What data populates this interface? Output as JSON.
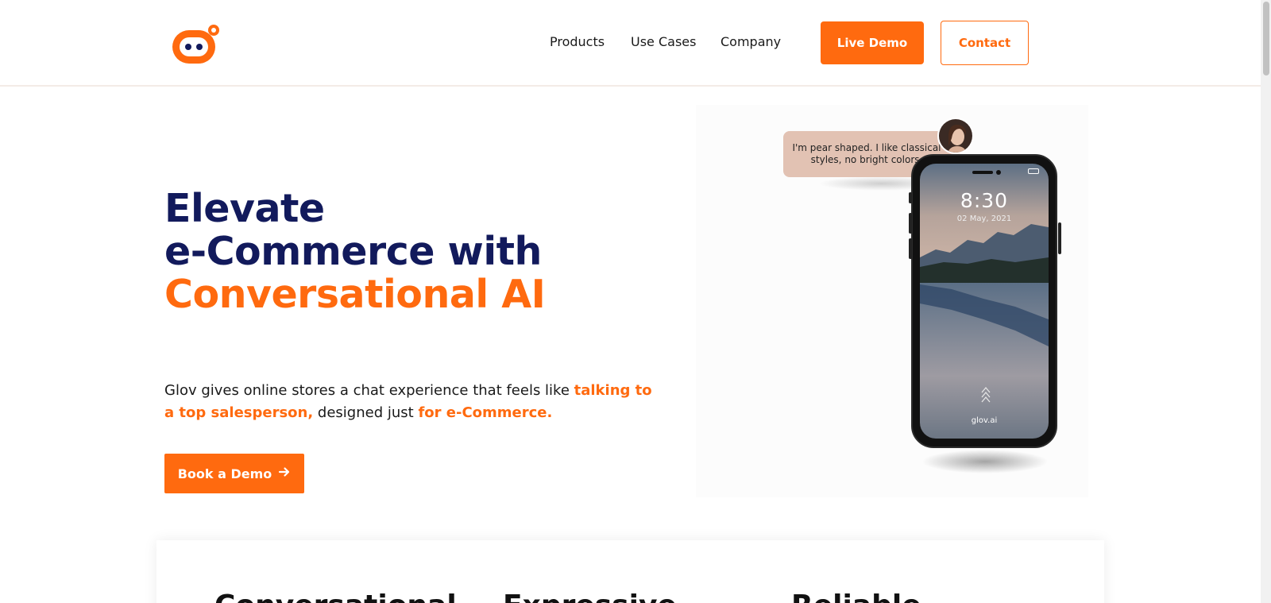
{
  "header": {
    "logo_icon": "glov-robot-logo",
    "nav": {
      "products": "Products",
      "use_cases": "Use Cases",
      "company": "Company"
    },
    "live_demo_label": "Live Demo",
    "contact_label": "Contact"
  },
  "hero": {
    "title_line1": "Elevate",
    "title_line2": "e-Commerce with",
    "title_line3": "Conversational AI",
    "desc_part1": "Glov gives online stores a chat experience that feels like ",
    "desc_highlight1": "talking to a top salesperson,",
    "desc_part2": " designed just ",
    "desc_highlight2": "for e-Commerce.",
    "cta_label": "Book a Demo",
    "cta_icon": "arrow-right-icon"
  },
  "visual": {
    "chat_message": "I'm pear shaped. I like classical styles, no bright colors.",
    "phone_time": "8:30",
    "phone_date": "02 May, 2021",
    "phone_brand": "glov.ai"
  },
  "features": {
    "title1": "Conversational",
    "title2": "Expressive",
    "title3": "Reliable"
  },
  "colors": {
    "accent": "#ff6a0f",
    "navy": "#121a5c"
  }
}
